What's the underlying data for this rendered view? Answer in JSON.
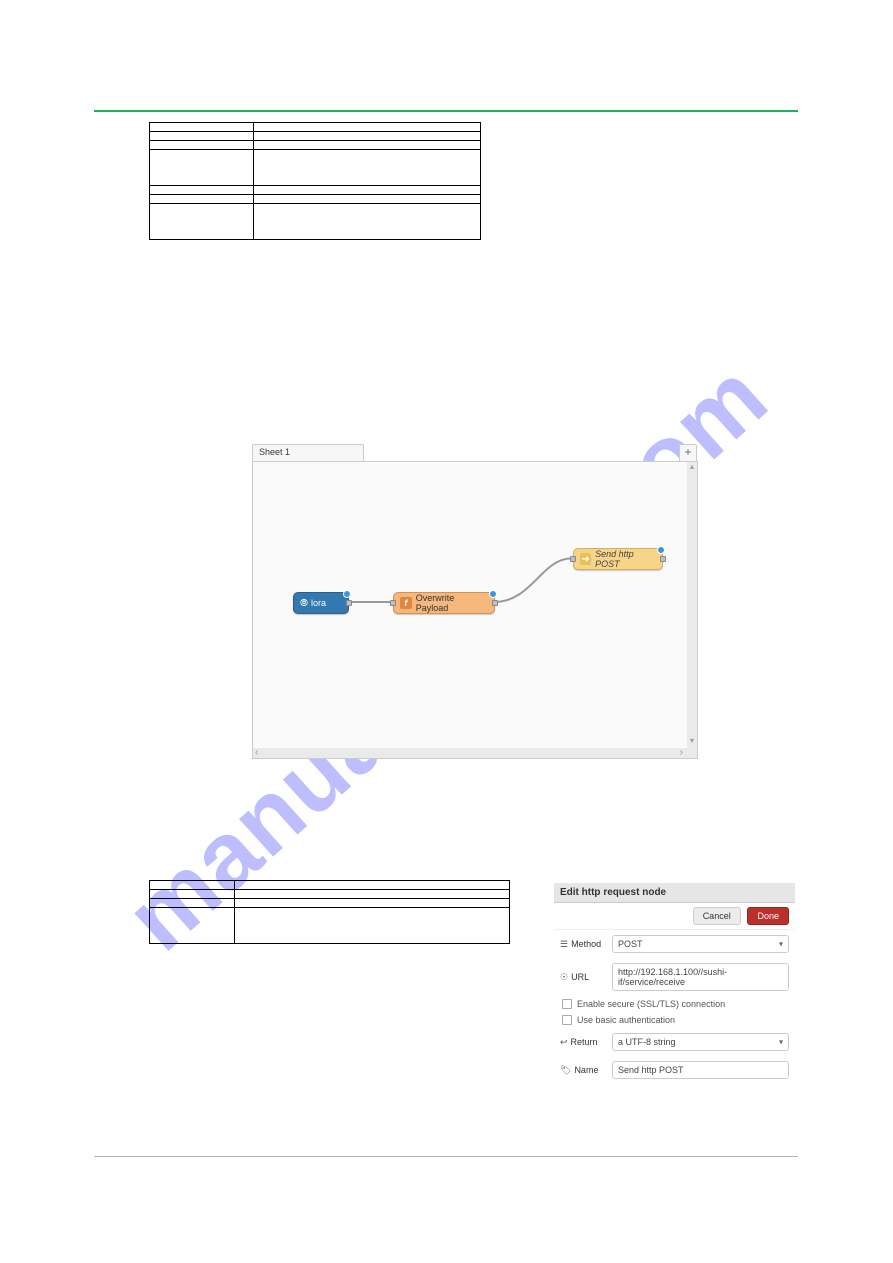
{
  "watermark": "manualshive.com",
  "tbl1": {
    "r0c0": "",
    "r0c1": "",
    "r1c0": "",
    "r1c1": "",
    "r2c0": "",
    "r2c1": "",
    "r3c0": "",
    "r3c1": "",
    "r4c0": "",
    "r4c1": "",
    "r5c0": "",
    "r5c1": "",
    "r6c0": "",
    "r6c1": ""
  },
  "flow": {
    "tab": "Sheet 1",
    "plus": "+",
    "lora": "lora",
    "fn": "Overwrite Payload",
    "http": "Send http POST"
  },
  "tbl2": {
    "r0c0": "",
    "r0c1": "",
    "r1c0": "",
    "r1c1": "",
    "r2c0": "",
    "r2c1": "",
    "r3c0": "",
    "r3c1": ""
  },
  "panel": {
    "title": "Edit http request node",
    "cancel": "Cancel",
    "done": "Done",
    "method_label": "Method",
    "method_val": "POST",
    "url_label": "URL",
    "url_val": "http://192.168.1.100//sushi-if/service/receive",
    "ssl": "Enable secure (SSL/TLS) connection",
    "basicauth": "Use basic authentication",
    "return_label": "Return",
    "return_val": "a UTF-8 string",
    "name_label": "Name",
    "name_val": "Send http POST"
  }
}
